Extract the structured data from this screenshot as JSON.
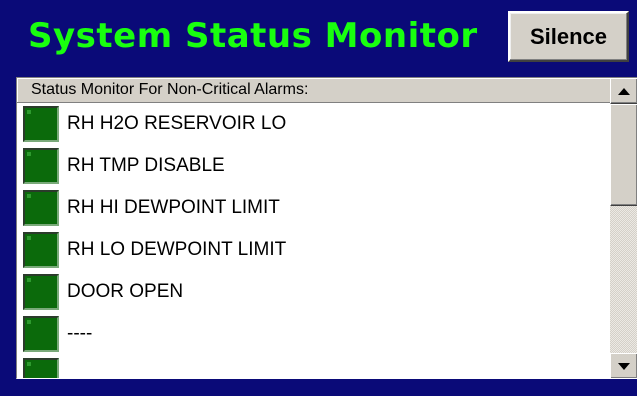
{
  "window": {
    "title": "System Status Monitor",
    "background_color": "#0a0a78",
    "title_color": "#19ff0f"
  },
  "toolbar": {
    "silence_label": "Silence"
  },
  "monitor": {
    "header": "Status Monitor For Non-Critical Alarms:",
    "indicator_color": "#0b6a0b",
    "items": [
      {
        "label": "RH H2O RESERVOIR LO",
        "status": "ok"
      },
      {
        "label": "RH TMP DISABLE",
        "status": "ok"
      },
      {
        "label": "RH HI DEWPOINT LIMIT",
        "status": "ok"
      },
      {
        "label": "RH LO DEWPOINT LIMIT",
        "status": "ok"
      },
      {
        "label": "DOOR OPEN",
        "status": "ok"
      },
      {
        "label": "----",
        "status": "ok"
      },
      {
        "label": "",
        "status": "ok"
      }
    ]
  },
  "scrollbar": {
    "up_icon": "arrow-up-icon",
    "down_icon": "arrow-down-icon"
  }
}
